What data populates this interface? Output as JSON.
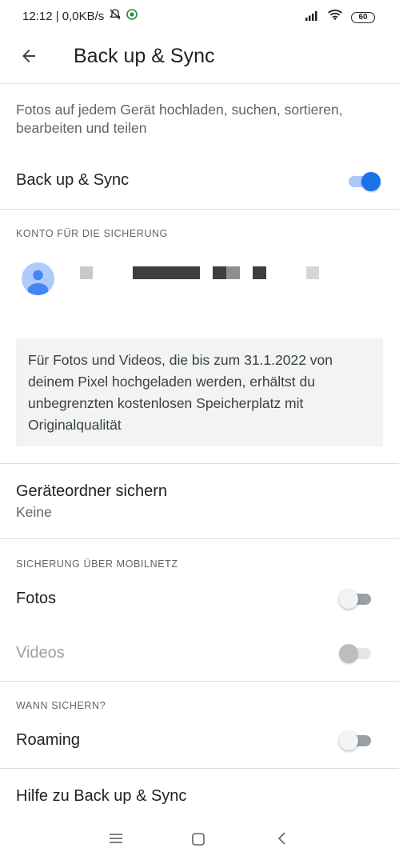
{
  "status_bar": {
    "time_speed": "12:12 | 0,0KB/s",
    "battery": "60"
  },
  "header": {
    "title": "Back up & Sync"
  },
  "description": "Fotos auf jedem Gerät hochladen, suchen, sortieren, bearbeiten und teilen",
  "backup_sync": {
    "label": "Back up & Sync",
    "enabled": true
  },
  "account": {
    "header": "KONTO FÜR DIE SICHERUNG"
  },
  "info_box": {
    "text": "Für Fotos und Videos, die bis zum 31.1.2022 von deinem Pixel hochgeladen werden, erhältst du unbegrenzten kostenlosen Speicherplatz mit Originalqualität"
  },
  "device_folders": {
    "title": "Geräteordner sichern",
    "value": "Keine"
  },
  "mobile_data": {
    "header": "SICHERUNG ÜBER MOBILNETZ",
    "photos_label": "Fotos",
    "photos_enabled": false,
    "videos_label": "Videos",
    "videos_enabled": false
  },
  "when_backup": {
    "header": "WANN SICHERN?",
    "roaming_label": "Roaming",
    "roaming_enabled": false
  },
  "help": {
    "label": "Hilfe zu Back up & Sync"
  },
  "colors": {
    "accent": "#1a73e8",
    "divider": "#dadce0",
    "info_bg": "#f1f3f4"
  }
}
